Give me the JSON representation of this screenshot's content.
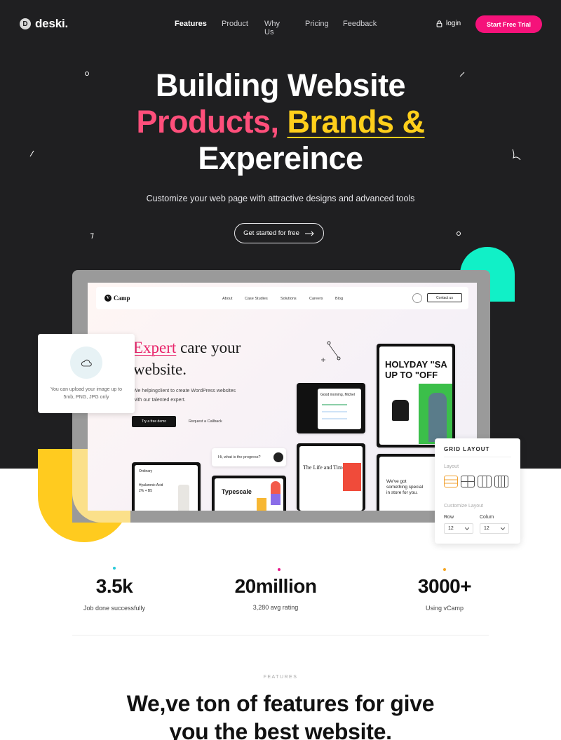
{
  "nav": {
    "logo_letter": "D",
    "logo_text": "deski.",
    "links": [
      "Features",
      "Product",
      "Why Us",
      "Pricing",
      "Feedback"
    ],
    "login": "login",
    "cta": "Start Free Trial"
  },
  "hero": {
    "line1": "Building Website",
    "line2_a": "Products,",
    "line2_b": "Brands &",
    "line3": "Expereince",
    "subtitle": "Customize your web page with attractive designs and advanced tools",
    "cta": "Get started for free",
    "colors": {
      "background": "#1f1f21",
      "pink": "#ff4f7b",
      "yellow": "#ffcf1b",
      "accent": "#f5127a",
      "teal": "#11f0c7"
    }
  },
  "mockup": {
    "brand": "Camp",
    "brand_letter": "V",
    "menu": [
      "About",
      "Case Studies",
      "Solutions",
      "Careers",
      "Blog"
    ],
    "contact": "Contact us",
    "headline_accent": "Expert",
    "headline_rest": " care your",
    "headline_line2": "website.",
    "body_line1": "We helpingclient  to create WordPress websites",
    "body_line2": "with our talented expert.",
    "btn_primary": "Try a free demo",
    "btn_link": "Request a Callback",
    "chat_placeholder": "Hi, what is the progress?",
    "card_holyday_1": "HOLYDAY \"SA",
    "card_holyday_2": "UP TO \"OFF",
    "card_greeting": "Good morning, Michel",
    "card_life": "The Life and Times",
    "card_typescale": "Typescale",
    "card_product": "Hyaluronic Acid",
    "card_product_sub": "2% + B5",
    "card_ordinary": "Ordinary",
    "card_special_1": "We've got",
    "card_special_2": "something special",
    "card_special_3": "in store for you."
  },
  "upload": {
    "line1": "You can upload your image up to",
    "line2": "5mb, PNG, JPG only"
  },
  "grid_panel": {
    "title": "GRID LAYOUT",
    "layout_label": "Layout",
    "customize_label": "Customize Layout",
    "row_label": "Row",
    "col_label": "Colum",
    "row_value": "12",
    "col_value": "12"
  },
  "stats": [
    {
      "value": "3.5k",
      "label": "Job done successfully",
      "dot": "#27c9d8"
    },
    {
      "value": "20million",
      "label": "3,280 avg rating",
      "dot": "#e6198a"
    },
    {
      "value": "3000+",
      "label": "Using vCamp",
      "dot": "#f6a623"
    }
  ],
  "features": {
    "tag": "FEATURES",
    "title_line1": "We,ve ton of features for give",
    "title_line2": "you the best website."
  }
}
